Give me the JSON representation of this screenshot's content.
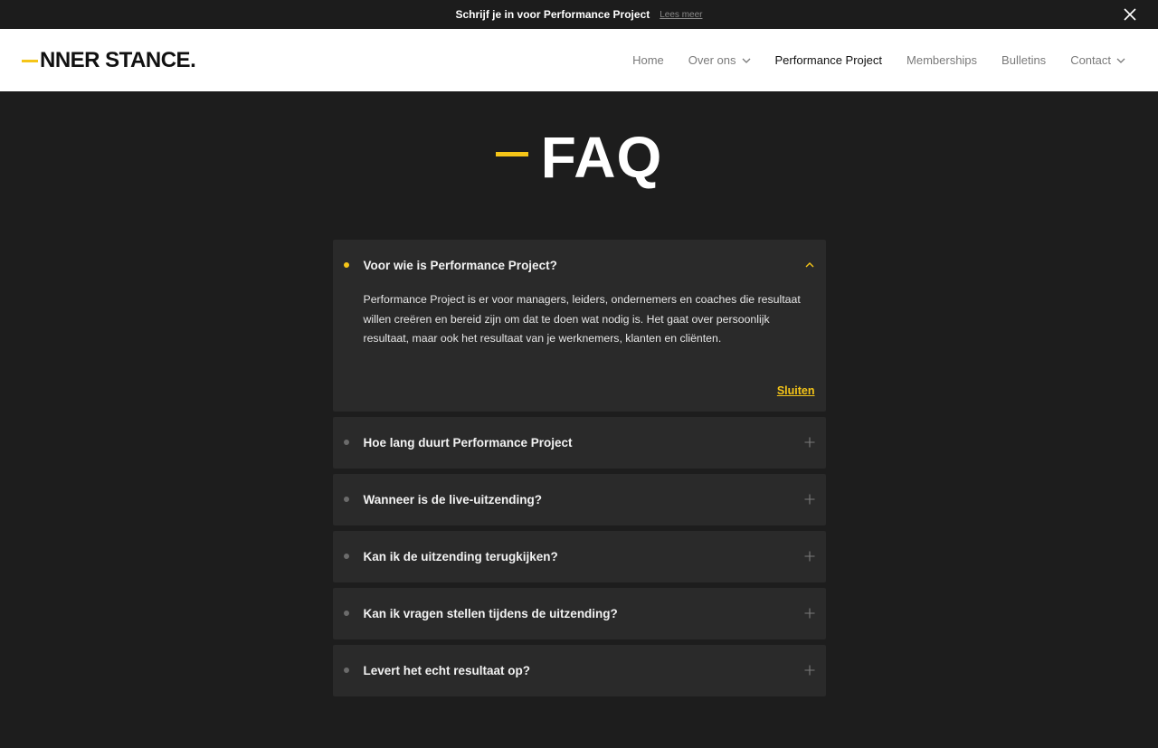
{
  "announcement": {
    "text": "Schrijf je in voor Performance Project",
    "link": "Lees meer"
  },
  "header": {
    "logo": "NNER STANCE.",
    "nav": [
      {
        "label": "Home"
      },
      {
        "label": "Over ons"
      },
      {
        "label": "Performance Project"
      },
      {
        "label": "Memberships"
      },
      {
        "label": "Bulletins"
      },
      {
        "label": "Contact"
      }
    ]
  },
  "hero": {
    "title": "FAQ"
  },
  "faq": {
    "items": [
      {
        "question": "Voor wie is Performance Project?",
        "answer": "Performance Project is er voor managers, leiders, ondernemers en coaches die resultaat willen creëren en bereid zijn om dat te doen wat nodig is. Het gaat over persoonlijk resultaat, maar ook het resultaat van je werknemers, klanten en cliënten.",
        "close_label": "Sluiten"
      },
      {
        "question": "Hoe lang duurt Performance Project"
      },
      {
        "question": "Wanneer is de live-uitzending?"
      },
      {
        "question": "Kan ik de uitzending terugkijken?"
      },
      {
        "question": "Kan ik vragen stellen tijdens de uitzending?"
      },
      {
        "question": "Levert het echt resultaat op?"
      }
    ]
  },
  "colors": {
    "accent": "#f5c518",
    "background": "#1d1d1d",
    "card": "#2a2a2a"
  }
}
